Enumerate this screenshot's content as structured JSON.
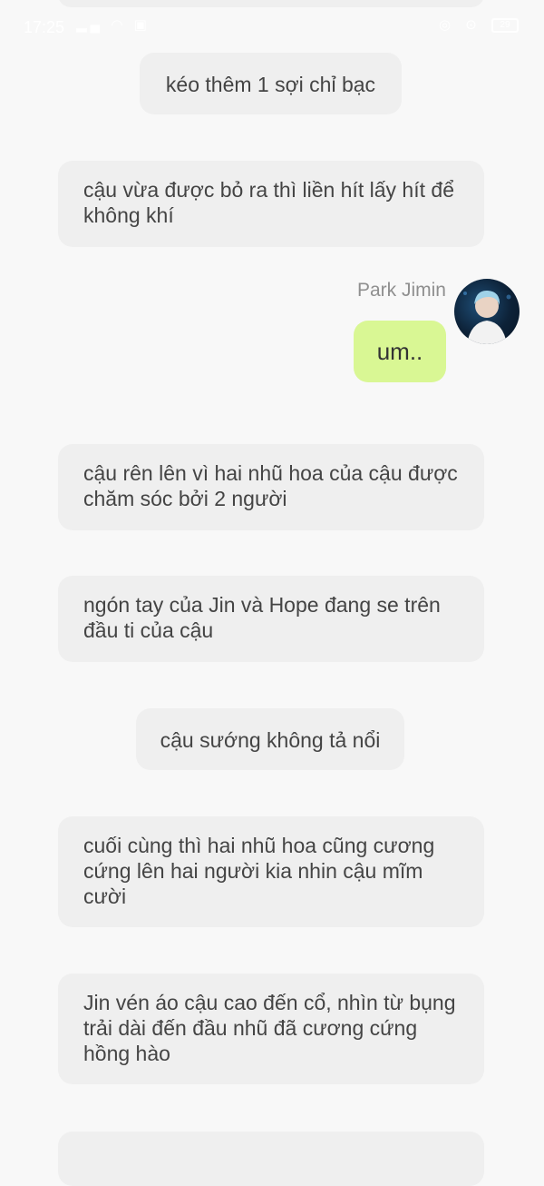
{
  "status_bar": {
    "time": "17:25",
    "battery_level": "29"
  },
  "messages": [
    {
      "text": "kéo thêm 1 sợi chỉ bạc"
    },
    {
      "text": "cậu vừa được bỏ ra thì liền hít lấy hít để không khí"
    },
    {
      "sender": "Park Jimin",
      "text": "um.."
    },
    {
      "text": "cậu rên lên vì hai nhũ hoa của cậu được chăm sóc bởi 2 người"
    },
    {
      "text": "ngón tay của Jin và Hope đang se trên đầu ti của cậu"
    },
    {
      "text": "cậu sướng không tả nổi"
    },
    {
      "text": "cuối cùng thì hai nhũ hoa cũng cương cứng lên hai người kia nhin cậu mĩm cười"
    },
    {
      "text": "Jin vén áo cậu cao đến cổ, nhìn từ bụng trải dài đến đầu nhũ đã cương cứng hồng hào"
    }
  ],
  "colors": {
    "background": "#f8f8f8",
    "narration_bubble": "#efefef",
    "user_bubble": "#d9f794",
    "text": "#444444",
    "sender_name": "#8f8f8f"
  }
}
